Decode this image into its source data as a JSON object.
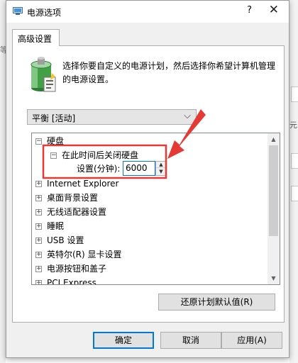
{
  "window": {
    "title": "电源选项",
    "help_label": "?",
    "close_label": "✕"
  },
  "tabs": [
    {
      "label": "高级设置",
      "active": true
    }
  ],
  "description": {
    "line1": "选择你要自定义的电源计划，然后选择你希望计算机管理",
    "line2": "的电源设置。"
  },
  "plan_select": {
    "value": "平衡 [活动]",
    "chevron": "⌵"
  },
  "tree": {
    "items": [
      {
        "label": "硬盘",
        "toggle": "−"
      },
      {
        "label": "在此时间后关闭硬盘",
        "toggle": "−"
      },
      {
        "label": "Internet Explorer",
        "toggle": "+"
      },
      {
        "label": "桌面背景设置",
        "toggle": "+"
      },
      {
        "label": "无线适配器设置",
        "toggle": "+"
      },
      {
        "label": "睡眠",
        "toggle": "+"
      },
      {
        "label": "USB 设置",
        "toggle": "+"
      },
      {
        "label": "英特尔(R) 显卡设置",
        "toggle": "+"
      },
      {
        "label": "电源按钮和盖子",
        "toggle": "+"
      },
      {
        "label": "PCI Express",
        "toggle": "+"
      }
    ],
    "setting_label": "设置(分钟):",
    "setting_value": "6000",
    "scroll_up": "▲",
    "scroll_down": "▼"
  },
  "buttons": {
    "restore": "还原计划默认值(R)",
    "ok": "确定",
    "cancel": "取消",
    "apply": "应用(A)"
  },
  "background": {
    "left_mark": "等",
    "right_mark": "元"
  },
  "colors": {
    "accent": "#0078d7",
    "annotation": "#e53935"
  },
  "icons": {
    "app": "power-options-icon",
    "battery": "battery-power-icon"
  }
}
